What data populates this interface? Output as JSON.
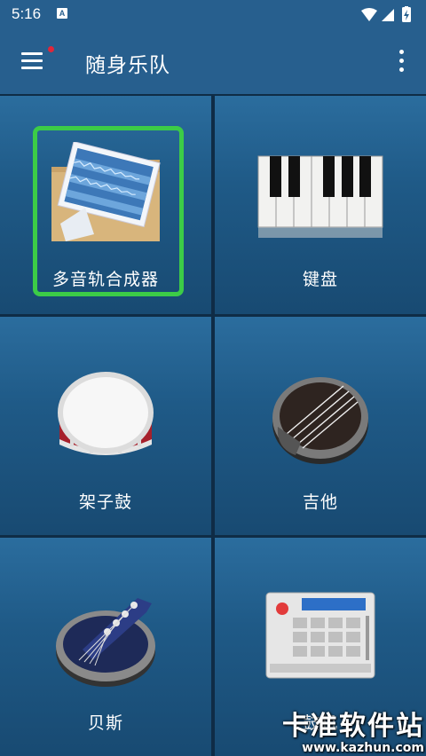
{
  "status_bar": {
    "time": "5:16",
    "app_icon_letter": "A",
    "icons": [
      "app-notification-icon",
      "wifi-icon",
      "signal-icon",
      "battery-icon"
    ]
  },
  "app_bar": {
    "title": "随身乐队",
    "menu_icon": "hamburger-menu-icon",
    "overflow_icon": "more-vert-icon",
    "notification_dot_color": "#e0263a"
  },
  "tiles": [
    {
      "label": "多音轨合成器",
      "icon": "multitrack-folder-icon",
      "highlighted": true
    },
    {
      "label": "键盘",
      "icon": "piano-keys-icon"
    },
    {
      "label": "架子鼓",
      "icon": "drum-icon"
    },
    {
      "label": "吉他",
      "icon": "guitar-icon"
    },
    {
      "label": "贝斯",
      "icon": "bass-icon"
    },
    {
      "label": "鼓机",
      "icon": "drum-machine-icon"
    }
  ],
  "highlight_color": "#3ccc47",
  "watermark": {
    "name": "卡准软件站",
    "url": "www.kazhun.com"
  }
}
